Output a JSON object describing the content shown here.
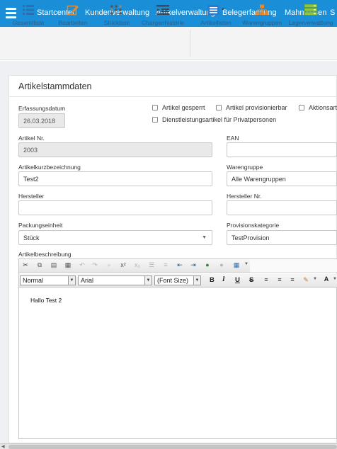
{
  "nav": {
    "items": [
      "Startcenter",
      "Kundenverwaltung",
      "Artikelverwaltung",
      "Belegerfassung",
      "Mahnwesen",
      "S"
    ]
  },
  "toolbar": {
    "items": [
      {
        "label": "Gesamtliste",
        "icon": "list-icon"
      },
      {
        "label": "Bearbeiten",
        "icon": "edit-icon"
      },
      {
        "label": "Stückliste",
        "icon": "bom-grid-icon"
      },
      {
        "label": "Chargenhistorie",
        "icon": "history-icon"
      },
      {
        "label": "Artikellisten",
        "icon": "article-list-icon"
      },
      {
        "label": "Warengruppen",
        "icon": "hierarchy-icon"
      },
      {
        "label": "Lagerverwaltung",
        "icon": "warehouse-icon"
      }
    ]
  },
  "form": {
    "title": "Artikelstammdaten",
    "erfassungsdatum": {
      "label": "Erfassungsdatum",
      "value": "26.03.2018"
    },
    "checkboxes": {
      "gesperrt": "Artikel gesperrt",
      "provisionierbar": "Artikel provisionierbar",
      "aktion": "Aktionsart",
      "dienstleistung": "Dienstleistungsartikel für Privatpersonen"
    },
    "artikel_nr": {
      "label": "Artikel Nr.",
      "value": "2003"
    },
    "ean": {
      "label": "EAN",
      "value": ""
    },
    "kurzbezeichnung": {
      "label": "Artikelkurzbezeichnung",
      "value": "Test2"
    },
    "warengruppe": {
      "label": "Warengruppe",
      "value": "Alle Warengruppen"
    },
    "hersteller": {
      "label": "Hersteller",
      "value": ""
    },
    "hersteller_nr": {
      "label": "Hersteller Nr.",
      "value": ""
    },
    "packungseinheit": {
      "label": "Packungseinheit",
      "value": "Stück"
    },
    "provisionskategorie": {
      "label": "Provisionskategorie",
      "value": "TestProvision"
    },
    "beschreibung": {
      "label": "Artikelbeschreibung"
    }
  },
  "editor": {
    "format": "Normal",
    "font": "Arial",
    "font_size": "(Font Size)",
    "bold": "B",
    "italic": "I",
    "underline": "U",
    "strike": "S",
    "content": "Hallo Test 2"
  }
}
